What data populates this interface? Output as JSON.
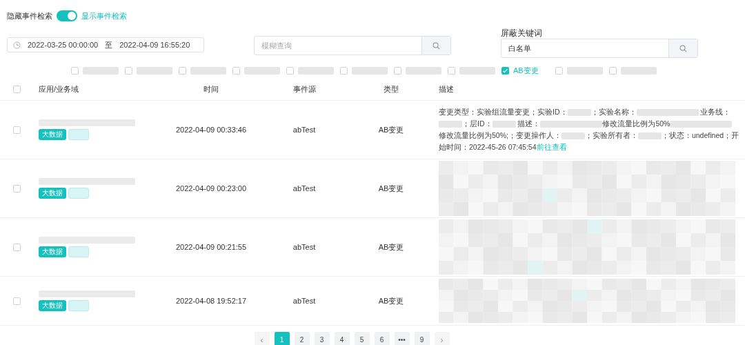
{
  "event_search_toggle": {
    "off_label": "隐藏事件检索",
    "on_label": "显示事件检索",
    "on": true
  },
  "date_range": {
    "start": "2022-03-25 00:00:00",
    "separator": "至",
    "end": "2022-04-09 16:55:20"
  },
  "fuzzy_search": {
    "placeholder": "模糊查询"
  },
  "blocked_keywords": {
    "label": "屏蔽关键词",
    "value": "白名单"
  },
  "filters": [
    {
      "checked": false
    },
    {
      "checked": false
    },
    {
      "checked": false
    },
    {
      "checked": false
    },
    {
      "checked": false
    },
    {
      "checked": false
    },
    {
      "checked": false
    },
    {
      "checked": false
    },
    {
      "label": "AB变更",
      "checked": true
    },
    {
      "checked": false
    },
    {
      "checked": false
    }
  ],
  "table": {
    "select_all": {
      "checked": false
    },
    "columns": [
      "应用/业务域",
      "时间",
      "事件源",
      "类型",
      "描述"
    ],
    "rows": [
      {
        "checked": false,
        "tags": [
          {
            "kind": "solid",
            "text": "大数据"
          },
          {
            "kind": "light"
          }
        ],
        "time": "2022-04-09 00:33:46",
        "source": "abTest",
        "type": "AB变更",
        "description": [
          {
            "kind": "text",
            "text": "变更类型：实验组流量变更；实验ID："
          },
          {
            "kind": "blur"
          },
          {
            "kind": "text",
            "text": "；实验名称："
          },
          {
            "kind": "blur",
            "wide": true
          },
          {
            "kind": "text",
            "text": " 业务线："
          },
          {
            "kind": "blur"
          },
          {
            "kind": "text",
            "text": "；层ID："
          },
          {
            "kind": "blur"
          },
          {
            "kind": "text",
            "text": " 描述："
          },
          {
            "kind": "blur",
            "wide": true
          },
          {
            "kind": "text",
            "text": "修改流量比例为50%"
          },
          {
            "kind": "blur",
            "wide": true
          },
          {
            "kind": "text",
            "text": "修改流量比例为50%;；变更操作人："
          },
          {
            "kind": "blur"
          },
          {
            "kind": "text",
            "text": "；实验所有者："
          },
          {
            "kind": "blur"
          },
          {
            "kind": "text",
            "text": "；状态：undefined；开始时间：2022-45-26 07:45:54"
          },
          {
            "kind": "link",
            "text": "前往查看"
          }
        ]
      },
      {
        "checked": false,
        "tags": [
          {
            "kind": "solid",
            "text": "大数据"
          },
          {
            "kind": "light"
          }
        ],
        "time": "2022-04-09 00:23:00",
        "source": "abTest",
        "type": "AB变更",
        "description": [
          {
            "kind": "mosaic"
          }
        ]
      },
      {
        "checked": false,
        "tags": [
          {
            "kind": "solid",
            "text": "大数据"
          },
          {
            "kind": "light"
          }
        ],
        "time": "2022-04-09 00:21:55",
        "source": "abTest",
        "type": "AB变更",
        "description": [
          {
            "kind": "mosaic"
          }
        ]
      },
      {
        "checked": false,
        "tags": [
          {
            "kind": "solid",
            "text": "大数据"
          },
          {
            "kind": "light"
          }
        ],
        "time": "2022-04-08 19:52:17",
        "source": "abTest",
        "type": "AB变更",
        "description": [
          {
            "kind": "mosaic"
          }
        ]
      }
    ]
  },
  "pagination": {
    "prev": "‹",
    "pages": [
      {
        "text": "1",
        "selected": true
      },
      {
        "text": "2",
        "selected": false
      },
      {
        "text": "3",
        "selected": false
      },
      {
        "text": "4",
        "selected": false
      },
      {
        "text": "5",
        "selected": false
      },
      {
        "text": "6",
        "selected": false
      },
      {
        "text": "•••",
        "selected": false
      },
      {
        "text": "9",
        "selected": false
      }
    ],
    "next": "›"
  }
}
